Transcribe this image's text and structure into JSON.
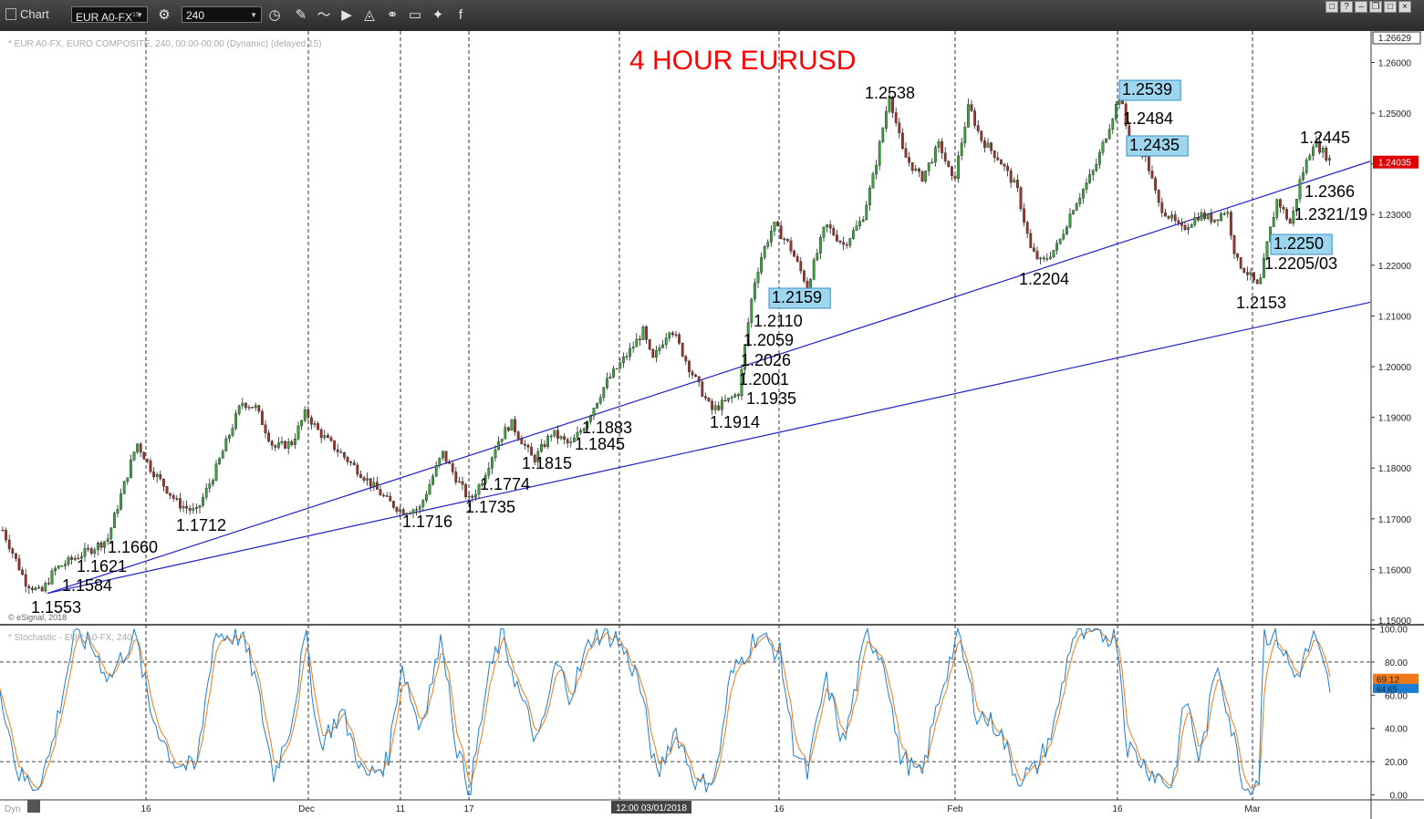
{
  "toolbar": {
    "title": "Chart",
    "symbol": "EUR A0-FX",
    "symbol_sup": "15",
    "interval": "240"
  },
  "chart_data": [
    {
      "type": "candlestick",
      "header": "* EUR A0-FX, EURO COMPOSITE, 240, 00:00-00:00 (Dynamic) (delayed 15)",
      "title": "4 HOUR EURUSD",
      "title_color": "#ff0000",
      "copyright": "© eSignal, 2018",
      "ylim": [
        1.15,
        1.2662
      ],
      "y_ticks": [
        1.26,
        1.25,
        1.24,
        1.23,
        1.22,
        1.21,
        1.2,
        1.19,
        1.18,
        1.17,
        1.16,
        1.15
      ],
      "y_tick_labels": [
        "1.26000",
        "1.25000",
        "1.24000",
        "1.23000",
        "1.22000",
        "1.21000",
        "1.20000",
        "1.19000",
        "1.18000",
        "1.17000",
        "1.16000",
        "1.15000"
      ],
      "top_label": "1.26629",
      "last_price": "1.24035",
      "x_tick_labels": [
        "16",
        "Dec",
        "11",
        "17",
        "16",
        "Feb",
        "16",
        "Mar"
      ],
      "crosshair_time_label": "12:00 03/01/2018",
      "grid": "vertical dashed",
      "colors": {
        "up": "#3aa53a",
        "down": "#a0322b",
        "trendline": "#2020c8",
        "highlight": "#9ed6ef"
      },
      "price_path_key_points": [
        [
          0,
          1.169
        ],
        [
          28,
          1.1575
        ],
        [
          45,
          1.1553
        ],
        [
          60,
          1.16
        ],
        [
          80,
          1.1621
        ],
        [
          100,
          1.164
        ],
        [
          118,
          1.166
        ],
        [
          140,
          1.179
        ],
        [
          150,
          1.185
        ],
        [
          165,
          1.18
        ],
        [
          195,
          1.173
        ],
        [
          215,
          1.1712
        ],
        [
          235,
          1.179
        ],
        [
          265,
          1.193
        ],
        [
          280,
          1.192
        ],
        [
          300,
          1.184
        ],
        [
          320,
          1.185
        ],
        [
          335,
          1.191
        ],
        [
          350,
          1.187
        ],
        [
          390,
          1.18
        ],
        [
          425,
          1.1735
        ],
        [
          440,
          1.1716
        ],
        [
          460,
          1.172
        ],
        [
          485,
          1.183
        ],
        [
          500,
          1.178
        ],
        [
          515,
          1.1735
        ],
        [
          528,
          1.1774
        ],
        [
          545,
          1.185
        ],
        [
          560,
          1.189
        ],
        [
          585,
          1.1815
        ],
        [
          605,
          1.187
        ],
        [
          625,
          1.1845
        ],
        [
          640,
          1.1883
        ],
        [
          665,
          1.197
        ],
        [
          690,
          1.203
        ],
        [
          705,
          1.207
        ],
        [
          715,
          1.201
        ],
        [
          735,
          1.208
        ],
        [
          755,
          1.2
        ],
        [
          780,
          1.1914
        ],
        [
          800,
          1.1935
        ],
        [
          810,
          1.195
        ],
        [
          818,
          1.2059
        ],
        [
          826,
          1.216
        ],
        [
          835,
          1.222
        ],
        [
          848,
          1.228
        ],
        [
          865,
          1.224
        ],
        [
          885,
          1.2159
        ],
        [
          905,
          1.228
        ],
        [
          925,
          1.224
        ],
        [
          945,
          1.229
        ],
        [
          958,
          1.238
        ],
        [
          975,
          1.2538
        ],
        [
          990,
          1.242
        ],
        [
          1010,
          1.237
        ],
        [
          1030,
          1.244
        ],
        [
          1045,
          1.236
        ],
        [
          1062,
          1.2515
        ],
        [
          1075,
          1.245
        ],
        [
          1095,
          1.241
        ],
        [
          1115,
          1.235
        ],
        [
          1130,
          1.223
        ],
        [
          1142,
          1.2204
        ],
        [
          1160,
          1.224
        ],
        [
          1175,
          1.231
        ],
        [
          1200,
          1.239
        ],
        [
          1215,
          1.247
        ],
        [
          1228,
          1.2539
        ],
        [
          1233,
          1.2484
        ],
        [
          1240,
          1.2435
        ],
        [
          1255,
          1.242
        ],
        [
          1270,
          1.232
        ],
        [
          1295,
          1.227
        ],
        [
          1315,
          1.23
        ],
        [
          1330,
          1.229
        ],
        [
          1345,
          1.231
        ],
        [
          1355,
          1.221
        ],
        [
          1370,
          1.218
        ],
        [
          1380,
          1.2153
        ],
        [
          1390,
          1.225
        ],
        [
          1400,
          1.233
        ],
        [
          1415,
          1.228
        ],
        [
          1425,
          1.2366
        ],
        [
          1440,
          1.2445
        ],
        [
          1460,
          1.2403
        ]
      ],
      "annotations": [
        {
          "text": "1.1553",
          "highlight": false
        },
        {
          "text": "1.1584",
          "highlight": false
        },
        {
          "text": "1.1621",
          "highlight": false
        },
        {
          "text": "1.1660",
          "highlight": false
        },
        {
          "text": "1.1712",
          "highlight": false
        },
        {
          "text": "1.1716",
          "highlight": false
        },
        {
          "text": "1.1735",
          "highlight": false
        },
        {
          "text": "1.1774",
          "highlight": false
        },
        {
          "text": "1.1815",
          "highlight": false
        },
        {
          "text": "1.1845",
          "highlight": false
        },
        {
          "text": "1.1883",
          "highlight": false
        },
        {
          "text": "1.1914",
          "highlight": false
        },
        {
          "text": "1.1935",
          "highlight": false
        },
        {
          "text": "1.2001",
          "highlight": false
        },
        {
          "text": "1.2026",
          "highlight": false
        },
        {
          "text": "1.2059",
          "highlight": false
        },
        {
          "text": "1.2110",
          "highlight": false
        },
        {
          "text": "1.2159",
          "highlight": true
        },
        {
          "text": "1.2538",
          "highlight": false
        },
        {
          "text": "1.2204",
          "highlight": false
        },
        {
          "text": "1.2539",
          "highlight": true
        },
        {
          "text": "1.2484",
          "highlight": false
        },
        {
          "text": "1.2435",
          "highlight": true
        },
        {
          "text": "1.2445",
          "highlight": false
        },
        {
          "text": "1.2366",
          "highlight": false
        },
        {
          "text": "1.2321/19",
          "highlight": false
        },
        {
          "text": "1.2250",
          "highlight": true
        },
        {
          "text": "1.2205/03",
          "highlight": false
        },
        {
          "text": "1.2153",
          "highlight": false
        }
      ],
      "trendlines": [
        {
          "from": [
            52,
            1.1553
          ],
          "to": [
            1502,
            1.2405
          ]
        },
        {
          "from": [
            52,
            1.1553
          ],
          "to": [
            1502,
            1.2127
          ]
        }
      ]
    },
    {
      "type": "line",
      "header": "* Stochastic - EUR A0-FX, 240",
      "ylim": [
        -3,
        103
      ],
      "y_ticks": [
        0,
        20,
        40,
        60,
        80,
        100
      ],
      "y_tick_labels": [
        "0.00",
        "20.00",
        "40.00",
        "60.00",
        "80.00",
        "100.00"
      ],
      "reference_lines": [
        80,
        20
      ],
      "last_values": [
        "69.12",
        "64.65"
      ],
      "series_colors": [
        "#1a7fd4",
        "#f07a1a"
      ],
      "key_points": [
        [
          0,
          65
        ],
        [
          20,
          12
        ],
        [
          40,
          5
        ],
        [
          55,
          25
        ],
        [
          82,
          97
        ],
        [
          100,
          90
        ],
        [
          120,
          70
        ],
        [
          148,
          97
        ],
        [
          165,
          50
        ],
        [
          190,
          20
        ],
        [
          215,
          15
        ],
        [
          235,
          97
        ],
        [
          265,
          95
        ],
        [
          280,
          70
        ],
        [
          300,
          12
        ],
        [
          320,
          45
        ],
        [
          335,
          97
        ],
        [
          350,
          30
        ],
        [
          375,
          50
        ],
        [
          400,
          10
        ],
        [
          425,
          20
        ],
        [
          440,
          80
        ],
        [
          460,
          40
        ],
        [
          485,
          95
        ],
        [
          500,
          30
        ],
        [
          515,
          2
        ],
        [
          535,
          70
        ],
        [
          550,
          97
        ],
        [
          570,
          60
        ],
        [
          590,
          30
        ],
        [
          610,
          80
        ],
        [
          625,
          60
        ],
        [
          650,
          97
        ],
        [
          675,
          95
        ],
        [
          700,
          70
        ],
        [
          720,
          10
        ],
        [
          740,
          40
        ],
        [
          765,
          5
        ],
        [
          785,
          12
        ],
        [
          800,
          70
        ],
        [
          830,
          97
        ],
        [
          855,
          85
        ],
        [
          870,
          30
        ],
        [
          885,
          12
        ],
        [
          905,
          70
        ],
        [
          925,
          30
        ],
        [
          950,
          97
        ],
        [
          970,
          80
        ],
        [
          985,
          25
        ],
        [
          1010,
          10
        ],
        [
          1030,
          60
        ],
        [
          1050,
          97
        ],
        [
          1070,
          50
        ],
        [
          1095,
          40
        ],
        [
          1115,
          10
        ],
        [
          1135,
          15
        ],
        [
          1155,
          40
        ],
        [
          1175,
          95
        ],
        [
          1200,
          97
        ],
        [
          1225,
          95
        ],
        [
          1235,
          30
        ],
        [
          1260,
          15
        ],
        [
          1285,
          5
        ],
        [
          1300,
          60
        ],
        [
          1315,
          20
        ],
        [
          1335,
          80
        ],
        [
          1350,
          40
        ],
        [
          1365,
          3
        ],
        [
          1380,
          10
        ],
        [
          1385,
          97
        ],
        [
          1400,
          95
        ],
        [
          1420,
          70
        ],
        [
          1440,
          95
        ],
        [
          1458,
          64
        ]
      ]
    }
  ]
}
